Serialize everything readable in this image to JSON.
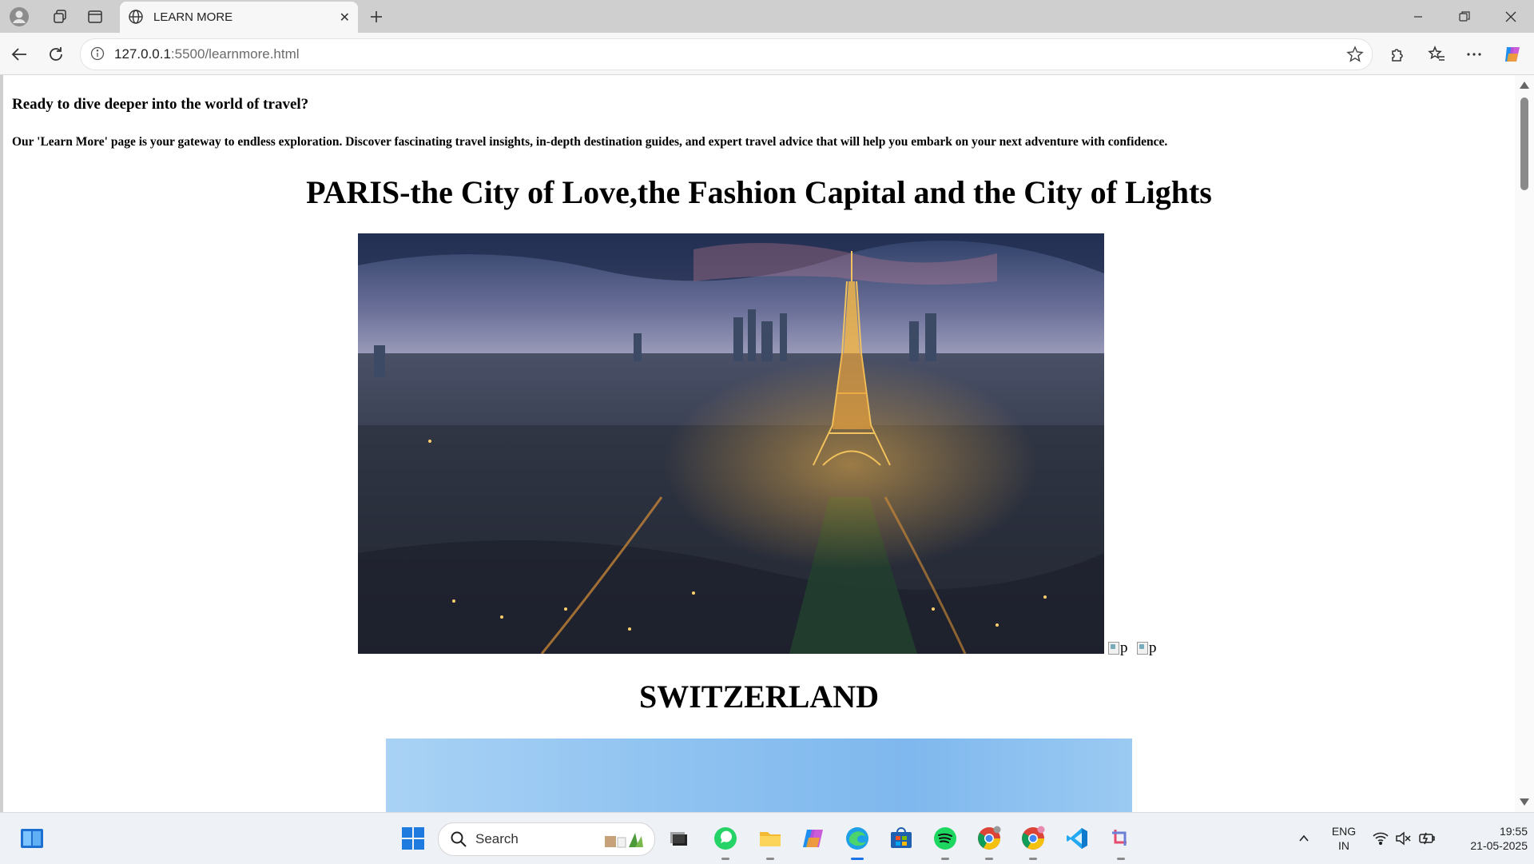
{
  "browser": {
    "tab_title": "LEARN MORE",
    "url_host": "127.0.0.1",
    "url_rest": ":5500/learnmore.html"
  },
  "page": {
    "intro_heading": "Ready to dive deeper into the world of travel?",
    "intro_text": "Our 'Learn More' page is your gateway to endless exploration. Discover fascinating travel insights, in-depth destination guides, and expert travel advice that will help you embark on your next adventure with confidence.",
    "paris_heading": "PARIS-the City of Love,the Fashion Capital and the City of Lights",
    "broken_img_1_alt": "p",
    "broken_img_2_alt": "p",
    "swiss_heading": "SWITZERLAND"
  },
  "taskbar": {
    "search_label": "Search",
    "lang_line1": "ENG",
    "lang_line2": "IN",
    "time": "19:55",
    "date": "21-05-2025"
  }
}
